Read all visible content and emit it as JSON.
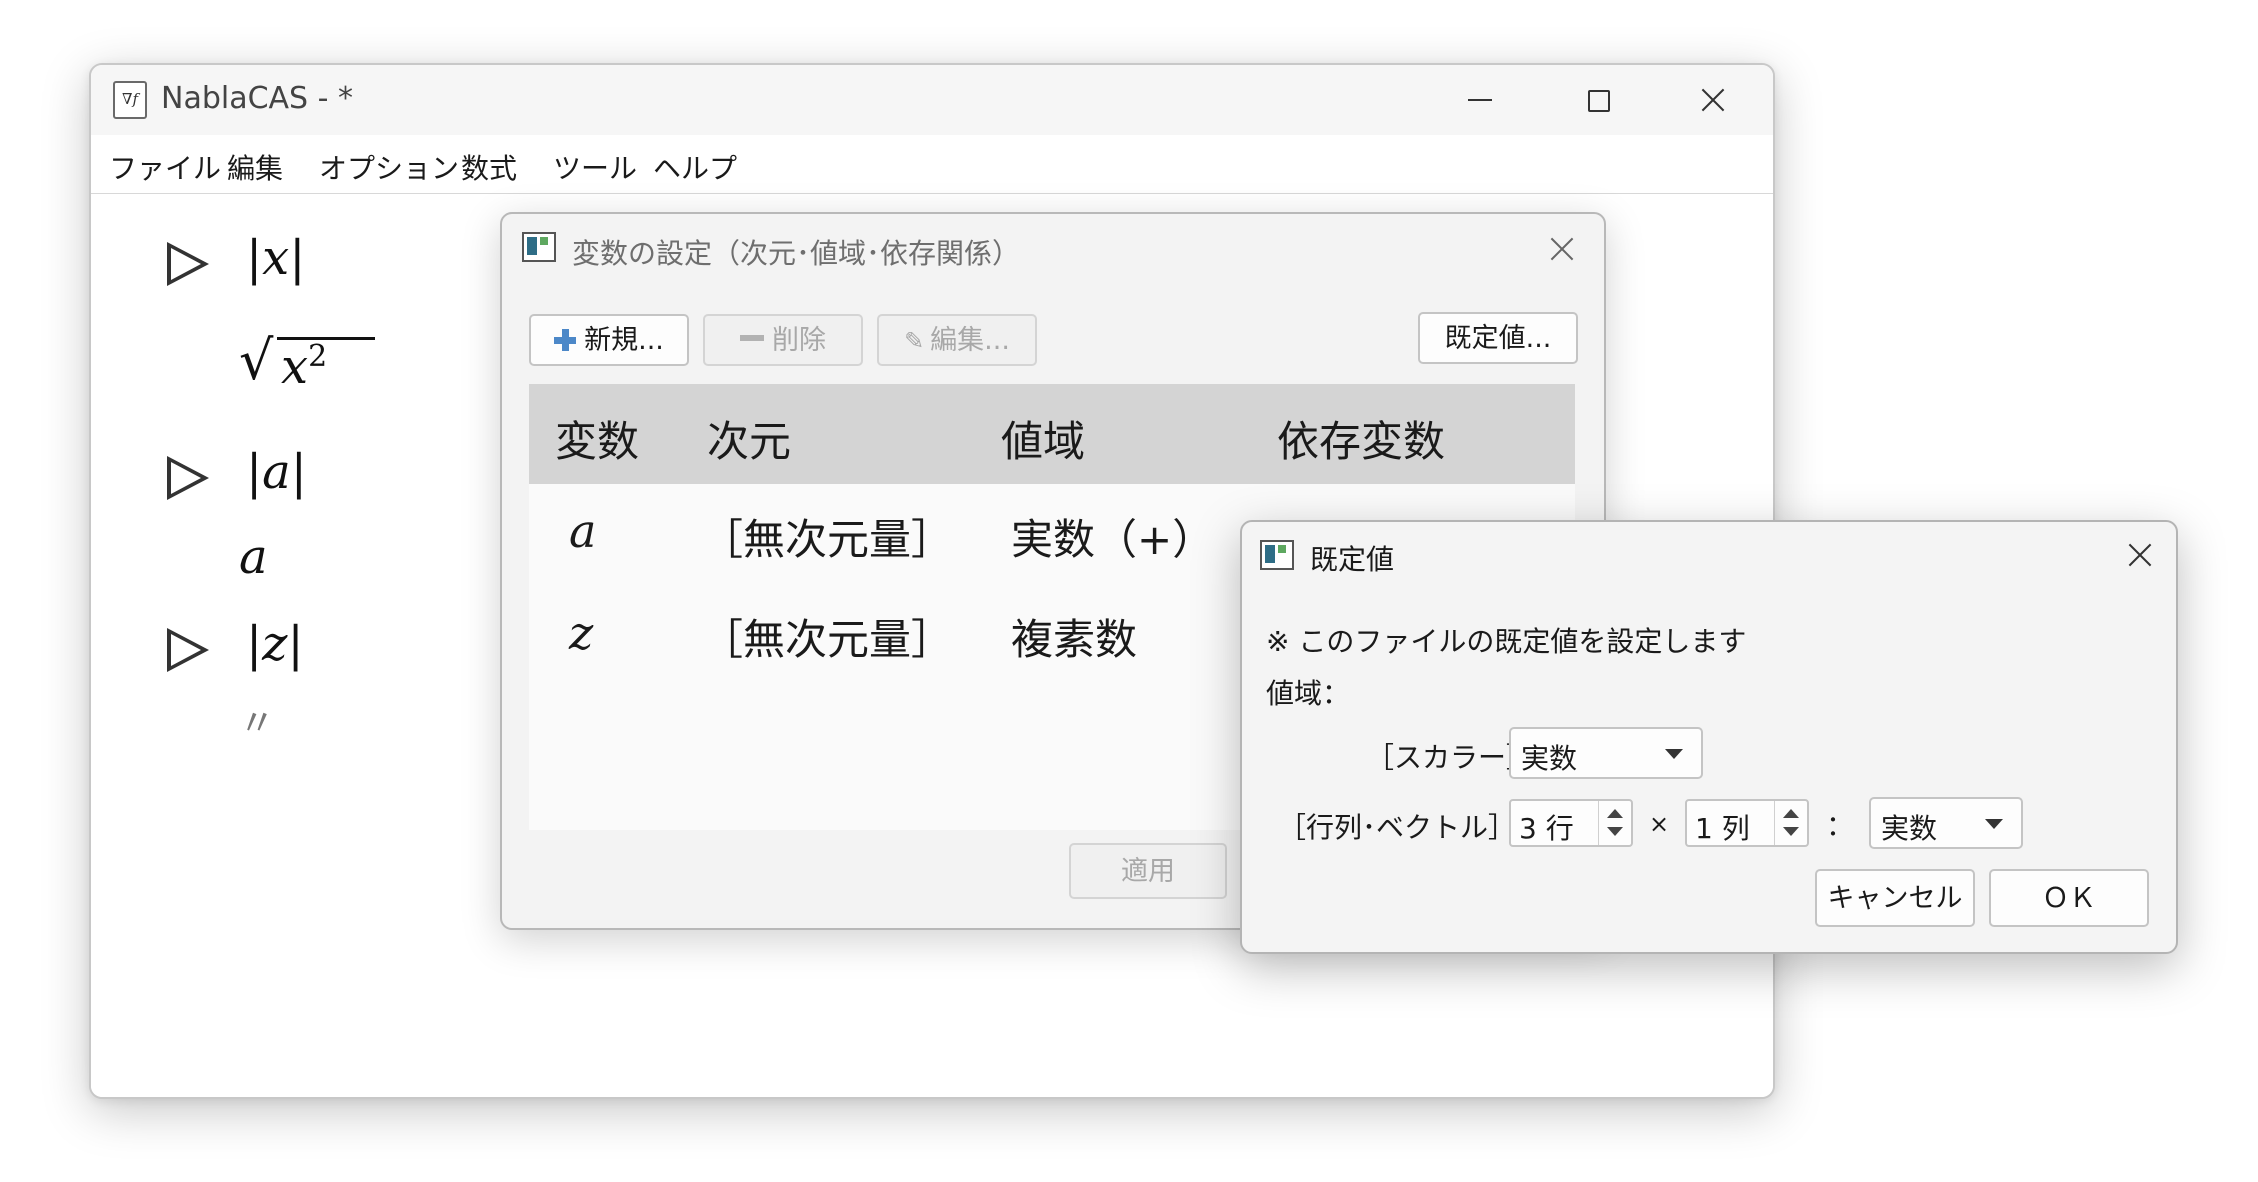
{
  "window": {
    "title": "NablaCAS - *",
    "icon": "nabla-f-icon"
  },
  "menu": [
    "ファイル",
    "編集",
    "オプション",
    "数式",
    "ツール",
    "ヘルプ"
  ],
  "document": {
    "entries": [
      {
        "input": "|x|",
        "input_var": "x",
        "output": "√(x²)",
        "output_var": "x",
        "output_exp": "2"
      },
      {
        "input": "|a|",
        "input_var": "a",
        "output": "a"
      },
      {
        "input": "|z|",
        "input_var": "z",
        "output": "〃"
      }
    ]
  },
  "var_dialog": {
    "title": "変数の設定（次元･値域･依存関係）",
    "buttons": {
      "new": "新規...",
      "delete": "削除",
      "edit": "編集...",
      "defaults": "既定値...",
      "apply": "適用"
    },
    "columns": [
      "変数",
      "次元",
      "値域",
      "依存変数"
    ],
    "rows": [
      {
        "var": "a",
        "dim": "［無次元量］",
        "range": "実数（+）",
        "deps": ""
      },
      {
        "var": "z",
        "dim": "［無次元量］",
        "range": "複素数",
        "deps": ""
      }
    ]
  },
  "def_dialog": {
    "title": "既定値",
    "note": "※ このファイルの既定値を設定します",
    "range_label": "値域：",
    "scalar_label": "［スカラー］",
    "scalar_value": "実数",
    "matrix_label": "［行列･ベクトル］",
    "rows_value": "3 行",
    "times": "×",
    "cols_value": "1 列",
    "colon": "：",
    "matrix_value": "実数",
    "cancel": "キャンセル",
    "ok": "ＯＫ"
  }
}
